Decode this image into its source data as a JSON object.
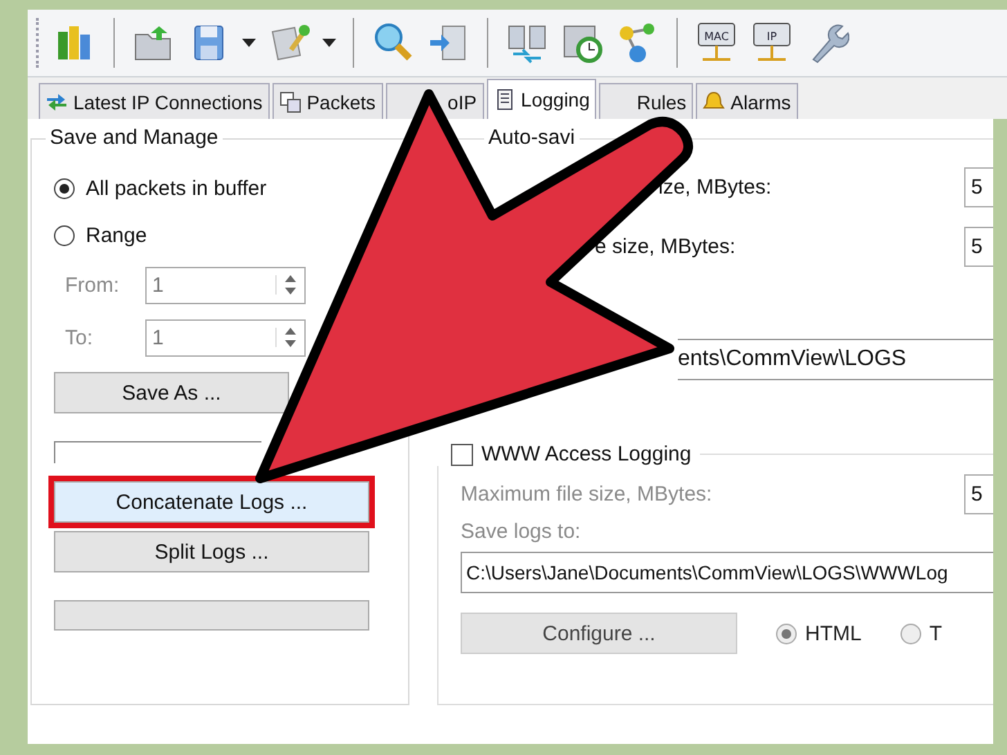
{
  "toolbar": {
    "mac_label": "MAC",
    "ip_label": "IP"
  },
  "tabs": [
    {
      "label": "Latest IP Connections",
      "selected": false
    },
    {
      "label": "Packets",
      "selected": false
    },
    {
      "label": "oIP",
      "selected": false
    },
    {
      "label": "Logging",
      "selected": true
    },
    {
      "label": "Rules",
      "selected": false
    },
    {
      "label": "Alarms",
      "selected": false
    }
  ],
  "save_and_manage": {
    "title": "Save and Manage",
    "options": [
      {
        "label": "All packets in buffer",
        "selected": true
      },
      {
        "label": "Range",
        "selected": false
      }
    ],
    "from": {
      "label": "From:",
      "value": "1"
    },
    "to": {
      "label": "To:",
      "value": "1"
    },
    "save_as": "Save As ...",
    "concatenate": {
      "label": "Concatenate Logs ...",
      "highlighted": true
    },
    "split": "Split Logs ...",
    "progress": {
      "level": 0
    }
  },
  "auto_saving": {
    "label": "Auto-savi",
    "max_dir": "ize, MBytes:",
    "max_dir_value": "5",
    "max_file": "e size, MBytes:",
    "max_file_value": "5",
    "path": "ents\\CommView\\LOGS"
  },
  "www": {
    "label": "WWW Access Logging",
    "checked": false,
    "max_label": "Maximum file size, MBytes:",
    "max_value": "5",
    "save_to": "Save logs to:",
    "path": "C:\\Users\\Jane\\Documents\\CommView\\LOGS\\WWWLog",
    "configure": "Configure ...",
    "formats": [
      {
        "label": "HTML",
        "selected": true
      },
      {
        "label": "T",
        "selected": false
      }
    ]
  }
}
